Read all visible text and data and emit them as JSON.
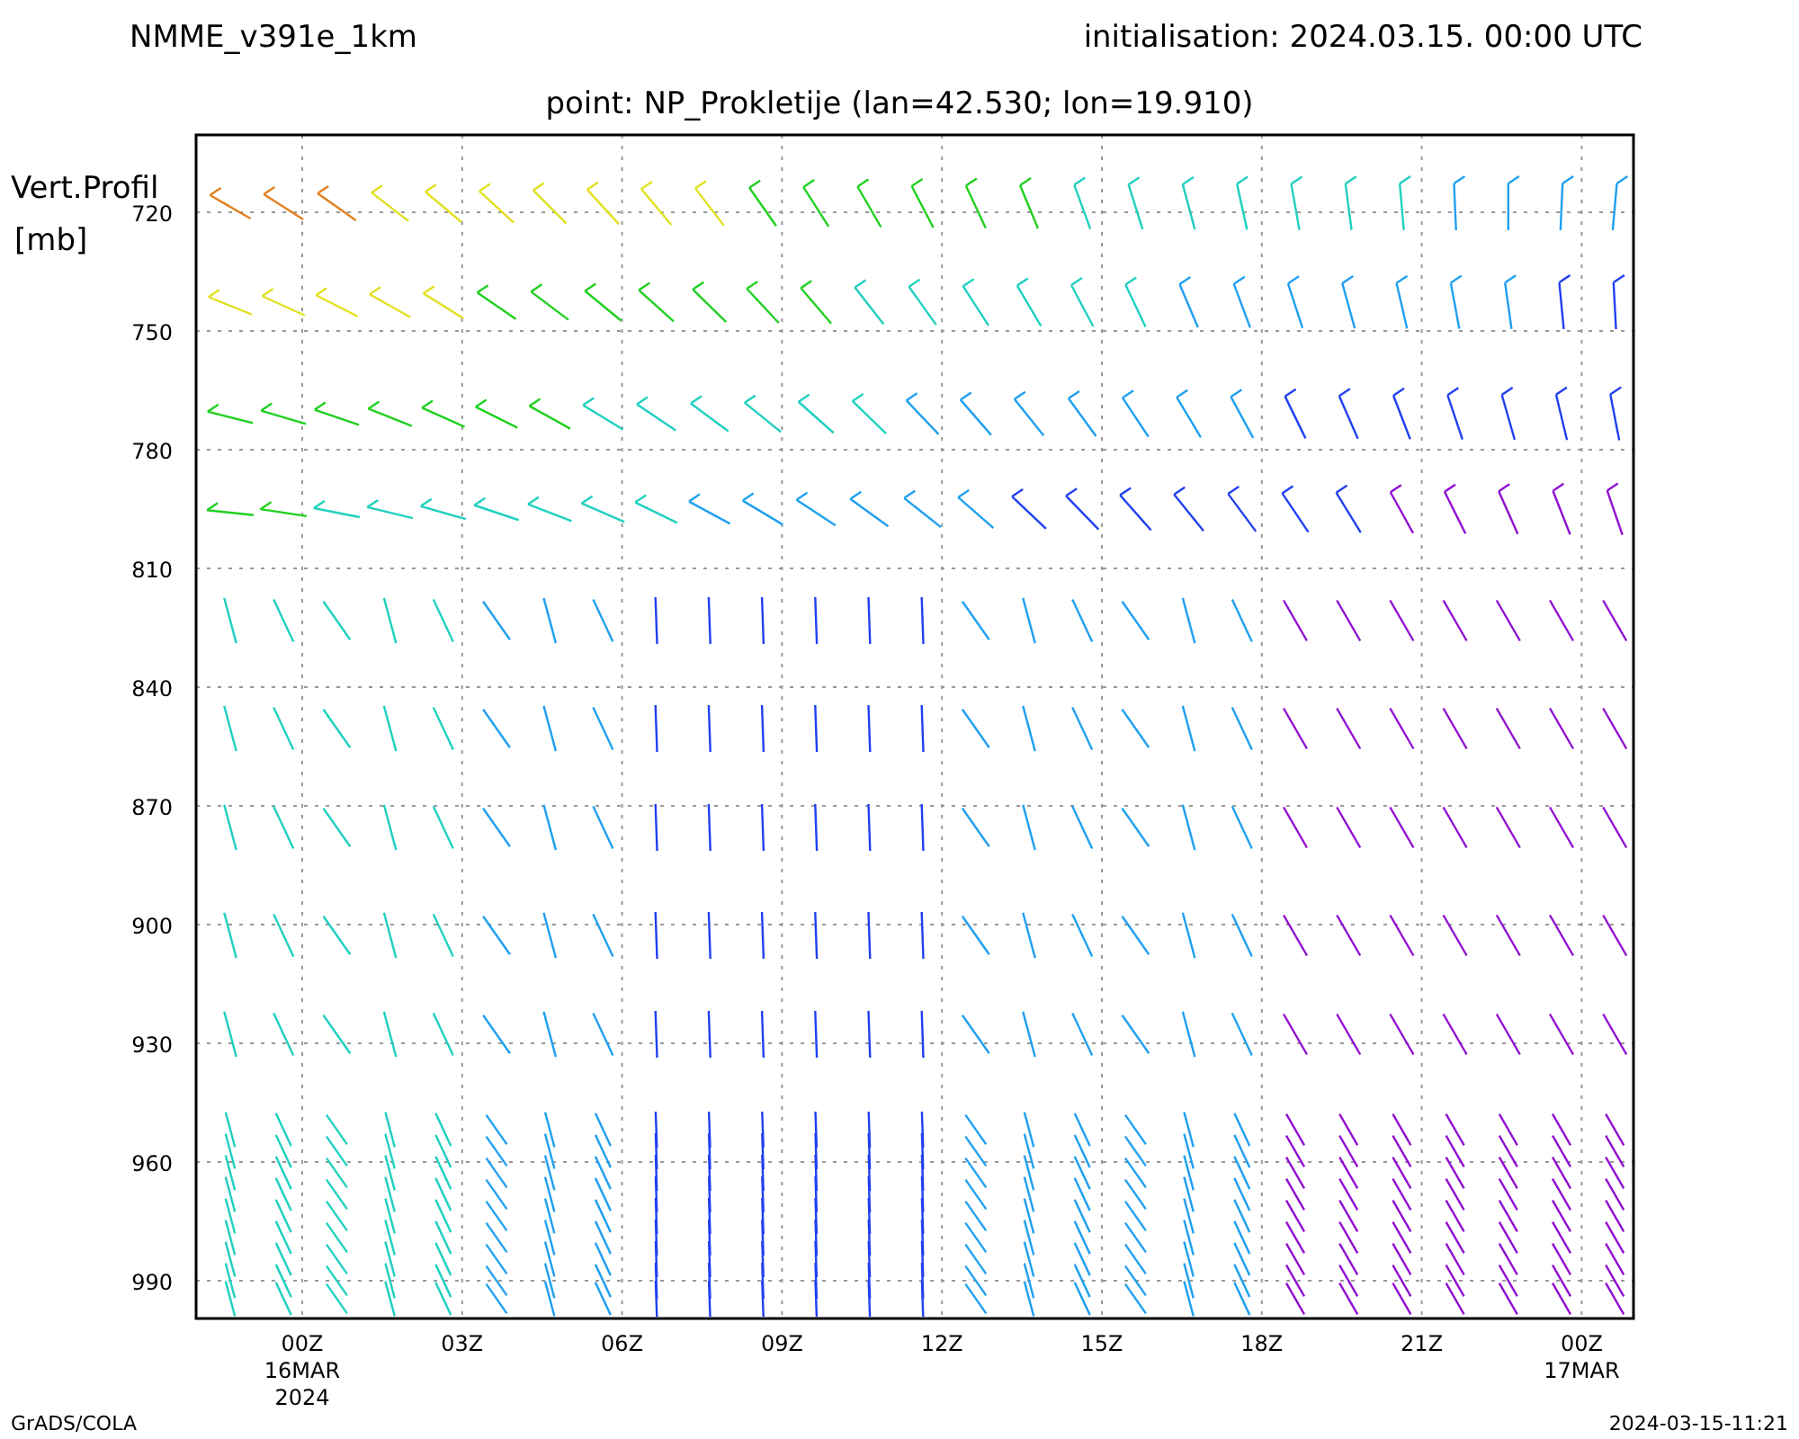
{
  "header": {
    "model": "NMME_v391e_1km",
    "initialisation": "initialisation: 2024.03.15. 00:00 UTC"
  },
  "title": "point: NP_Prokletije (lan=42.530; lon=19.910)",
  "y_axis": {
    "label": "Vert.Profil",
    "unit": "[mb]",
    "ticks": [
      "720",
      "750",
      "780",
      "810",
      "840",
      "870",
      "900",
      "930",
      "960",
      "990"
    ]
  },
  "x_axis": {
    "ticks": [
      {
        "label": "00Z",
        "date": "16MAR",
        "year": "2024"
      },
      {
        "label": "03Z"
      },
      {
        "label": "06Z"
      },
      {
        "label": "09Z"
      },
      {
        "label": "12Z"
      },
      {
        "label": "15Z"
      },
      {
        "label": "18Z"
      },
      {
        "label": "21Z"
      },
      {
        "label": "00Z",
        "date": "17MAR"
      }
    ]
  },
  "footer": {
    "left": "GrADS/COLA",
    "right": "2024-03-15-11:21"
  }
}
